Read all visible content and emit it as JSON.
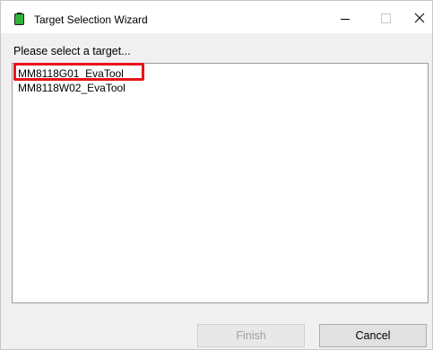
{
  "window": {
    "title": "Target Selection Wizard",
    "icon": "green-battery-icon"
  },
  "titlebar_buttons": {
    "minimize": "minimize-icon",
    "maximize": "maximize-icon",
    "close": "close-icon"
  },
  "prompt": "Please select a target...",
  "targets": [
    {
      "label": "MM8118G01_EvaTool",
      "highlighted": true
    },
    {
      "label": "MM8118W02_EvaTool",
      "highlighted": false
    }
  ],
  "buttons": {
    "finish_label": "Finish",
    "finish_enabled": false,
    "cancel_label": "Cancel"
  },
  "colors": {
    "highlight": "#e8141a",
    "icon_green": "#2fb43a",
    "client_bg": "#f0f0f0"
  }
}
